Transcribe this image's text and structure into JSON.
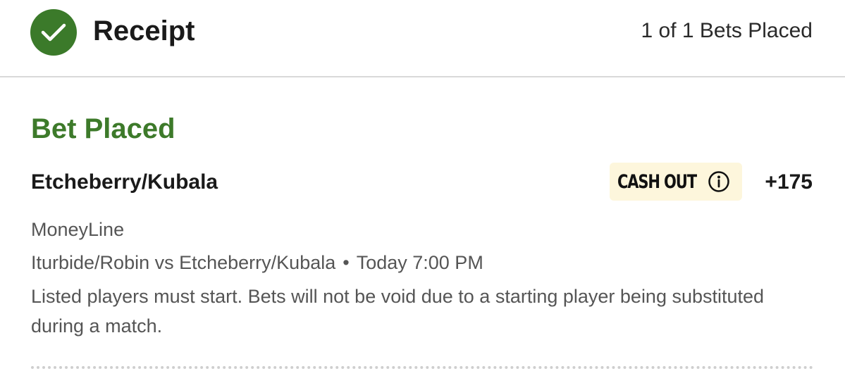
{
  "header": {
    "title": "Receipt",
    "bets_placed": "1 of 1 Bets Placed",
    "status_icon": "checkmark-circle-icon",
    "status_color": "#3b7a2a"
  },
  "bet": {
    "status": "Bet Placed",
    "selection": "Etcheberry/Kubala",
    "cash_out_label": "CASH OUT",
    "cash_out_icon": "info-icon",
    "odds": "+175",
    "market": "MoneyLine",
    "event": {
      "matchup": "Iturbide/Robin vs Etcheberry/Kubala",
      "separator": "•",
      "time": "Today 7:00 PM"
    },
    "rules": "Listed players must start. Bets will not be void due to a starting player being substituted during a match."
  }
}
